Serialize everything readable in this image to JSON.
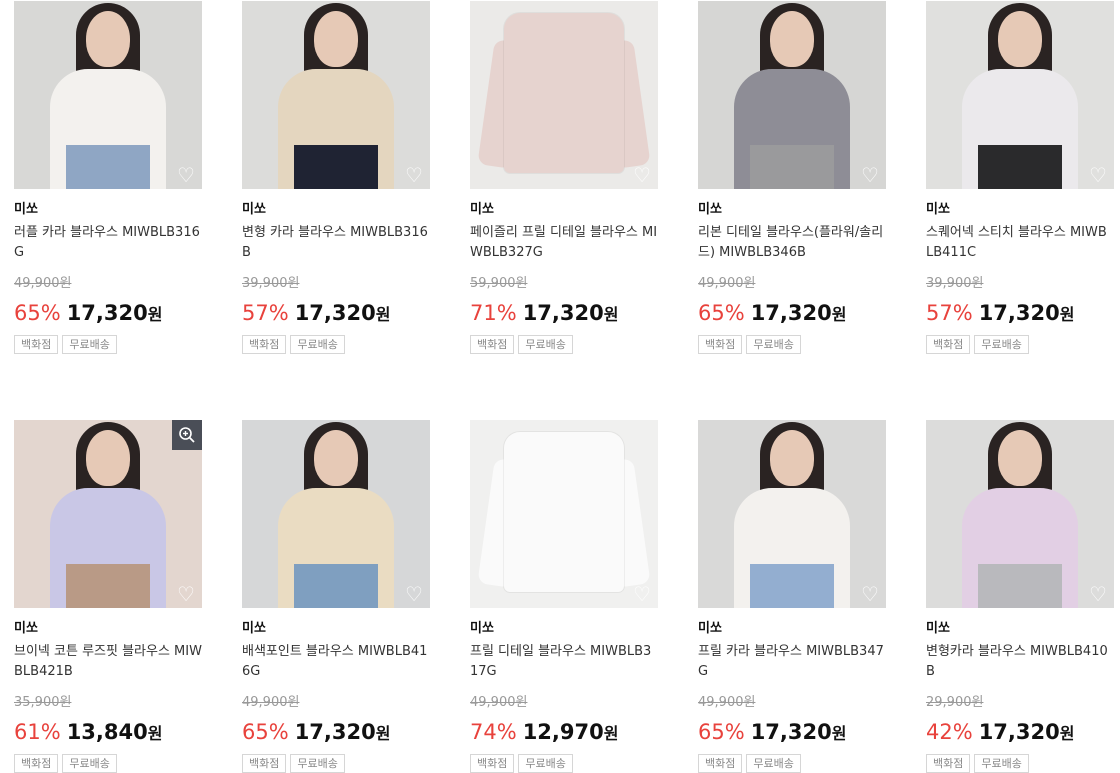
{
  "products": [
    {
      "brand": "미쏘",
      "name": "러플 카라 블라우스 MIWBLB316G",
      "orig": "49,900원",
      "disc": "65%",
      "price": "17,320",
      "won": "원",
      "tags": [
        "백화점",
        "무료배송"
      ],
      "colors": {
        "bg": "#d8d8d6",
        "top": "#f3f1ee",
        "legs": "#8fa6c4"
      },
      "style": "model"
    },
    {
      "brand": "미쏘",
      "name": "변형 카라 블라우스 MIWBLB316B",
      "orig": "39,900원",
      "disc": "57%",
      "price": "17,320",
      "won": "원",
      "tags": [
        "백화점",
        "무료배송"
      ],
      "colors": {
        "bg": "#dcdcda",
        "top": "#e4d6bf",
        "legs": "#1f2333"
      },
      "style": "model"
    },
    {
      "brand": "미쏘",
      "name": "페이즐리 프릴 디테일 블라우스 MIWBLB327G",
      "orig": "59,900원",
      "disc": "71%",
      "price": "17,320",
      "won": "원",
      "tags": [
        "백화점",
        "무료배송"
      ],
      "colors": {
        "bg": "#ebeae8",
        "top": "#e6d3cf",
        "legs": "#e6d3cf"
      },
      "style": "flat"
    },
    {
      "brand": "미쏘",
      "name": "리본 디테일 블라우스(플라워/솔리드) MIWBLB346B",
      "orig": "49,900원",
      "disc": "65%",
      "price": "17,320",
      "won": "원",
      "tags": [
        "백화점",
        "무료배송"
      ],
      "colors": {
        "bg": "#d6d6d4",
        "top": "#8e8d96",
        "legs": "#9a9a9c"
      },
      "style": "model"
    },
    {
      "brand": "미쏘",
      "name": "스퀘어넥 스티치 블라우스 MIWBLB411C",
      "orig": "39,900원",
      "disc": "57%",
      "price": "17,320",
      "won": "원",
      "tags": [
        "백화점",
        "무료배송"
      ],
      "colors": {
        "bg": "#e0e0de",
        "top": "#ebe9ec",
        "legs": "#2a2a2c"
      },
      "style": "model"
    },
    {
      "brand": "미쏘",
      "name": "브이넥 코튼 루즈핏 블라우스 MIWBLB421B",
      "orig": "35,900원",
      "disc": "61%",
      "price": "13,840",
      "won": "원",
      "tags": [
        "백화점",
        "무료배송"
      ],
      "colors": {
        "bg": "#e3d6cf",
        "top": "#c9c7e6",
        "legs": "#b99a86"
      },
      "style": "model"
    },
    {
      "brand": "미쏘",
      "name": "배색포인트 블라우스 MIWBLB416G",
      "orig": "49,900원",
      "disc": "65%",
      "price": "17,320",
      "won": "원",
      "tags": [
        "백화점",
        "무료배송"
      ],
      "colors": {
        "bg": "#d6d7d8",
        "top": "#eadcc2",
        "legs": "#7f9fc0"
      },
      "style": "model"
    },
    {
      "brand": "미쏘",
      "name": "프릴 디테일 블라우스 MIWBLB317G",
      "orig": "49,900원",
      "disc": "74%",
      "price": "12,970",
      "won": "원",
      "tags": [
        "백화점",
        "무료배송"
      ],
      "colors": {
        "bg": "#f0f0ef",
        "top": "#fafafa",
        "legs": "#fafafa"
      },
      "style": "flat"
    },
    {
      "brand": "미쏘",
      "name": "프릴 카라 블라우스 MIWBLB347G",
      "orig": "49,900원",
      "disc": "65%",
      "price": "17,320",
      "won": "원",
      "tags": [
        "백화점",
        "무료배송"
      ],
      "colors": {
        "bg": "#d9d9d8",
        "top": "#f3f1ee",
        "legs": "#93aed0"
      },
      "style": "model"
    },
    {
      "brand": "미쏘",
      "name": "변형카라 블라우스 MIWBLB410B",
      "orig": "29,900원",
      "disc": "42%",
      "price": "17,320",
      "won": "원",
      "tags": [
        "백화점",
        "무료배송"
      ],
      "colors": {
        "bg": "#dcdcdb",
        "top": "#e2cfe4",
        "legs": "#b9b9bd"
      },
      "style": "model"
    }
  ],
  "icons": {
    "wishlist": "heart-outline-icon",
    "zoom": "zoom-in-icon"
  }
}
